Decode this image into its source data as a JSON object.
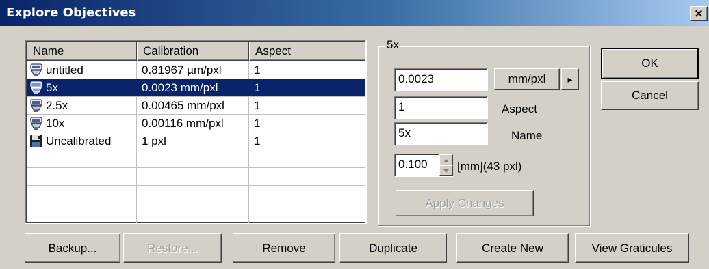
{
  "window": {
    "title": "Explore Objectives",
    "close_glyph": "×"
  },
  "list": {
    "columns": [
      "Name",
      "Calibration",
      "Aspect"
    ],
    "rows": [
      {
        "name": "untitled",
        "calibration": "0.81967 µm/pxl",
        "aspect": "1",
        "icon": "objective-icon"
      },
      {
        "name": "5x",
        "calibration": "0.0023 mm/pxl",
        "aspect": "1",
        "icon": "objective-icon",
        "selected": true
      },
      {
        "name": "2.5x",
        "calibration": "0.00465 mm/pxl",
        "aspect": "1",
        "icon": "objective-icon"
      },
      {
        "name": "10x",
        "calibration": "0.00116 mm/pxl",
        "aspect": "1",
        "icon": "objective-icon"
      },
      {
        "name": "Uncalibrated",
        "calibration": "1 pxl",
        "aspect": "1",
        "icon": "floppy-disk-icon"
      }
    ]
  },
  "details": {
    "group_title": "5x",
    "calibration_value": "0.0023",
    "unit_label": "mm/pxl",
    "unit_menu_glyph": "▸",
    "aspect_value": "1",
    "aspect_label": "Aspect",
    "name_value": "5x",
    "name_label": "Name",
    "graticule_value": "0.100",
    "graticule_label": "[mm](43 pxl)",
    "apply_label": "Apply Changes"
  },
  "buttons": {
    "ok": "OK",
    "cancel": "Cancel",
    "backup": "Backup...",
    "restore": "Restore...",
    "remove": "Remove",
    "duplicate": "Duplicate",
    "create_new": "Create New",
    "view_graticules": "View Graticules"
  },
  "colors": {
    "selection": "#0a246a",
    "face": "#d4d0c8"
  }
}
